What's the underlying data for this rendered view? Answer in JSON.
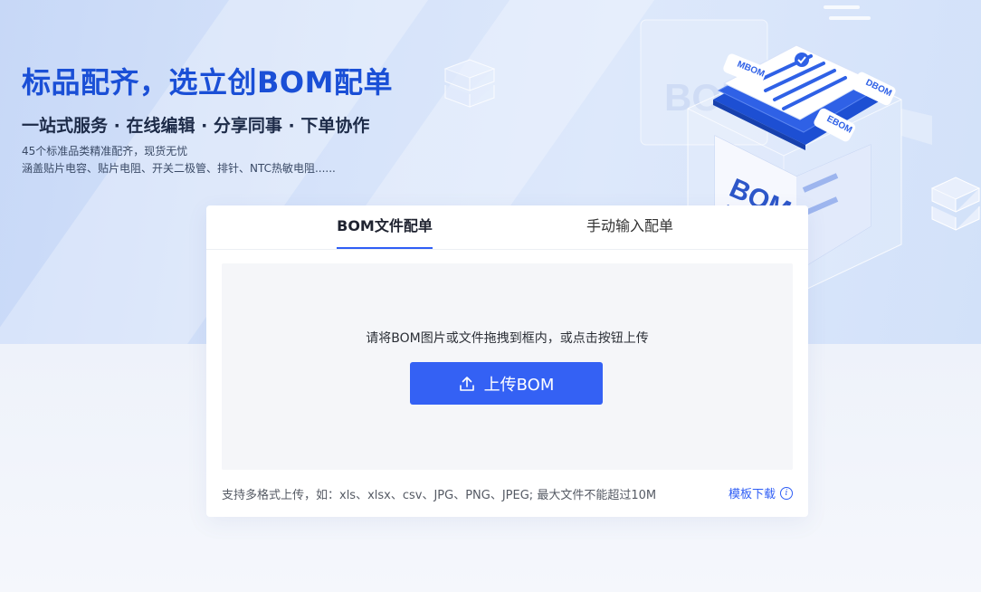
{
  "hero": {
    "title": "标品配齐，选立创BOM配单",
    "subtitle": "一站式服务 · 在线编辑 · 分享同事 · 下单协作",
    "desc_line1": "45个标准品类精准配齐，现货无忧",
    "desc_line2": "涵盖贴片电容、贴片电阻、开关二极管、排针、NTC热敏电阻......",
    "illustration": {
      "labels": [
        "MBOM",
        "DBOM",
        "EBOM"
      ],
      "box_text": "BOM",
      "folder_text": "BOM"
    }
  },
  "tabs": [
    {
      "label": "BOM文件配单",
      "active": true
    },
    {
      "label": "手动输入配单",
      "active": false
    }
  ],
  "upload": {
    "hint": "请将BOM图片或文件拖拽到框内，或点击按钮上传",
    "button_label": "上传BOM",
    "icon": "upload-icon"
  },
  "footer": {
    "formats_text": "支持多格式上传，如：xls、xlsx、csv、JPG、PNG、JPEG; 最大文件不能超过10M",
    "template_link": "模板下载",
    "info_icon": "info-icon"
  },
  "colors": {
    "accent": "#3461f4",
    "title_blue": "#1a4fd6",
    "hero_bg": "#d6e3fa"
  }
}
